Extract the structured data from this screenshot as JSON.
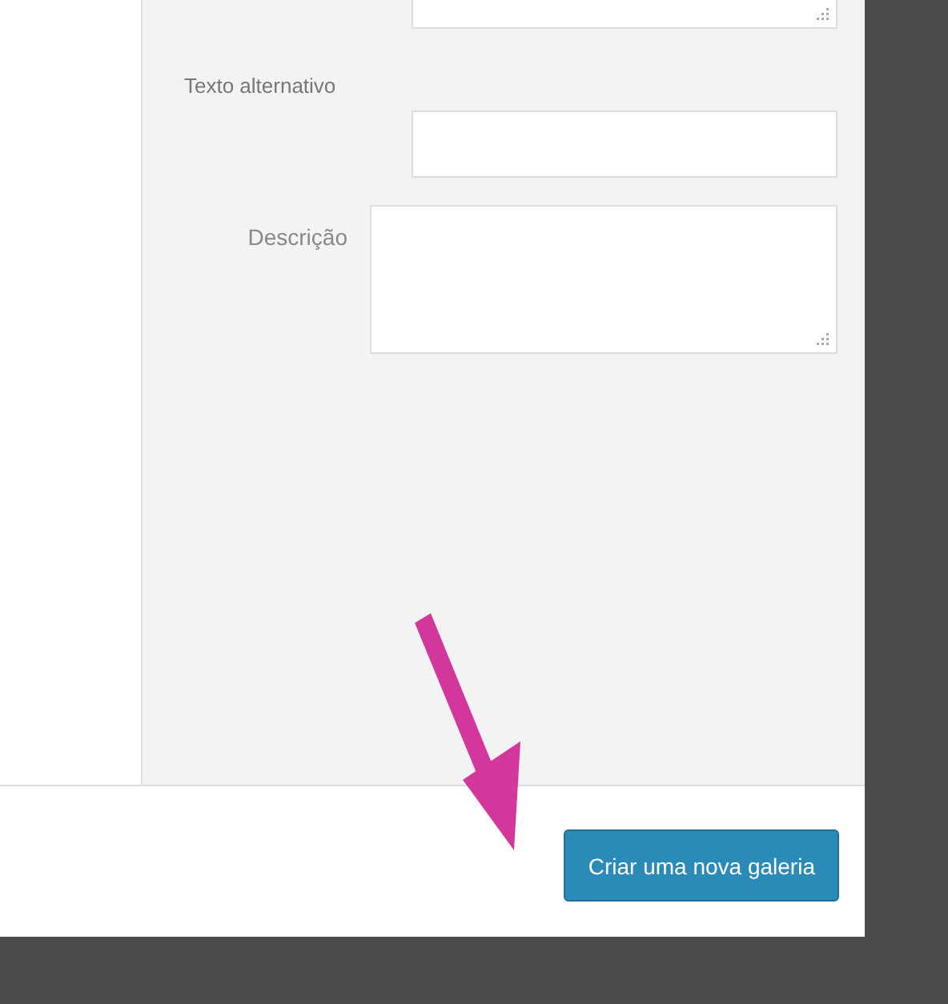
{
  "fields": [
    {
      "kind": "input",
      "label": "Texto alternativo"
    },
    {
      "kind": "textarea",
      "label": "Descrição"
    }
  ],
  "footer": {
    "button": "Criar uma nova galeria"
  }
}
